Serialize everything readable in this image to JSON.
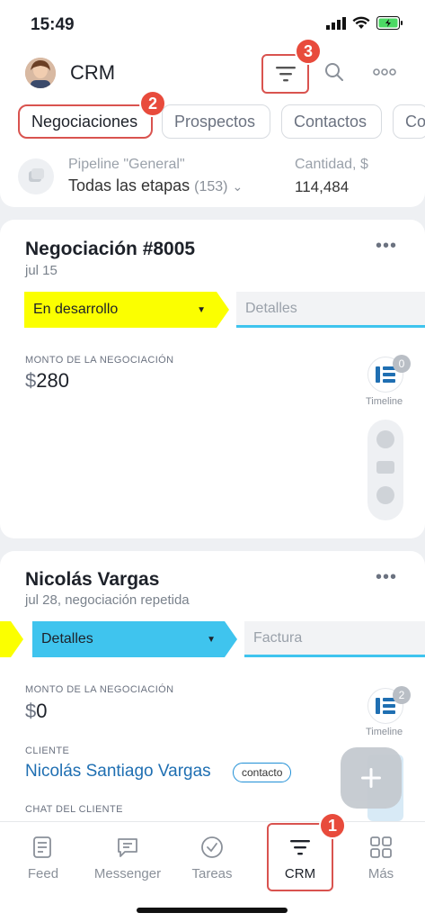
{
  "status_bar": {
    "time": "15:49"
  },
  "header": {
    "title": "CRM",
    "callout_filter": "3",
    "callout_tab": "2",
    "callout_nav": "1"
  },
  "tabs": [
    {
      "label": "Negociaciones"
    },
    {
      "label": "Prospectos"
    },
    {
      "label": "Contactos"
    },
    {
      "label": "Co"
    }
  ],
  "pipeline": {
    "label": "Pipeline \"General\"",
    "stages": "Todas las etapas",
    "count": "(153)",
    "qty_label": "Cantidad, $",
    "qty_value": "114,484"
  },
  "deals": [
    {
      "title": "Negociación #8005",
      "date": "jul 15",
      "stage_current": "En desarrollo",
      "stage_next": "Detalles",
      "amount_label": "MONTO DE LA NEGOCIACIÓN",
      "currency": "$",
      "amount": "280",
      "timeline_count": "0",
      "timeline_label": "Timeline"
    },
    {
      "title": "Nicolás Vargas",
      "date": "jul 28, negociación repetida",
      "stage_current": "Detalles",
      "stage_next": "Factura",
      "amount_label": "MONTO DE LA NEGOCIACIÓN",
      "currency": "$",
      "amount": "0",
      "timeline_count": "2",
      "timeline_label": "Timeline",
      "client_label": "CLIENTE",
      "client_name": "Nicolás Santiago Vargas",
      "client_tag": "contacto",
      "chat_label": "CHAT DEL CLIENTE"
    }
  ],
  "nav": [
    {
      "label": "Feed"
    },
    {
      "label": "Messenger"
    },
    {
      "label": "Tareas"
    },
    {
      "label": "CRM"
    },
    {
      "label": "Más"
    }
  ],
  "colors": {
    "stage_yellow": "#fbff00",
    "stage_blue": "#3fc4ee",
    "callout_red": "#e84b3c",
    "link_blue": "#1f6fb2"
  }
}
